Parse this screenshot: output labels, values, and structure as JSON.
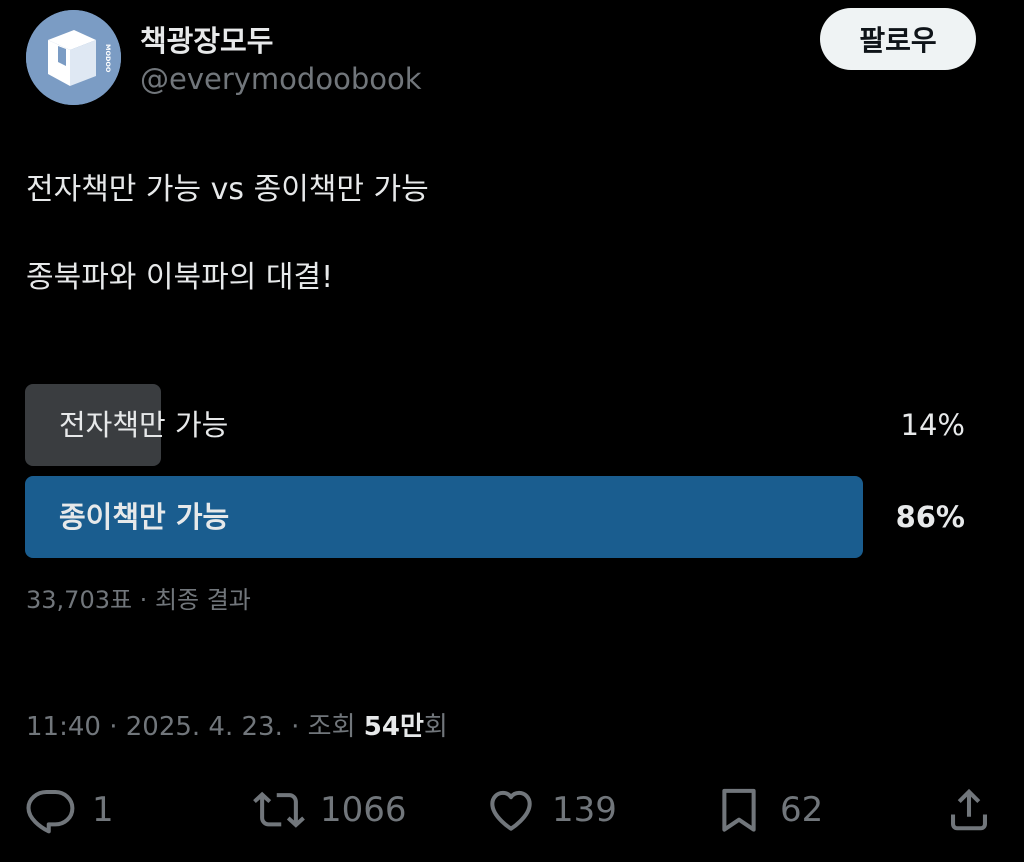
{
  "profile": {
    "display_name": "책광장모두",
    "handle": "@everymodoobook",
    "avatar_icon": "book-cube-logo",
    "avatar_color": "#7b9cc4",
    "avatar_vertical_text": "MODOO"
  },
  "header": {
    "follow_label": "팔로우"
  },
  "tweet": {
    "text": "전자책만 가능 vs 종이책만 가능\n\n종북파와 이북파의 대결!"
  },
  "poll": {
    "options": [
      {
        "label": "전자책만 가능",
        "percent_label": "14%",
        "percent": 14,
        "winner": false,
        "fill_color": "#3a3d40"
      },
      {
        "label": "종이책만 가능",
        "percent_label": "86%",
        "percent": 86,
        "winner": true,
        "fill_color": "#1a5d8f"
      }
    ],
    "summary": "33,703표 · 최종 결과"
  },
  "meta": {
    "time": "11:40",
    "sep1": " · ",
    "date": "2025. 4. 23.",
    "sep2": " · ",
    "views_prefix": "조회 ",
    "views_count": "54만",
    "views_suffix": "회"
  },
  "actions": {
    "reply": {
      "icon": "reply-icon",
      "count": "1"
    },
    "retweet": {
      "icon": "retweet-icon",
      "count": "1066"
    },
    "like": {
      "icon": "heart-icon",
      "count": "139"
    },
    "bookmark": {
      "icon": "bookmark-icon",
      "count": "62"
    },
    "share": {
      "icon": "share-icon"
    }
  },
  "colors": {
    "background": "#000000",
    "text_primary": "#e7e9ea",
    "text_secondary": "#71767b",
    "winner_bar": "#1a5d8f",
    "loser_bar": "#3a3d40",
    "follow_bg": "#eff3f4"
  }
}
